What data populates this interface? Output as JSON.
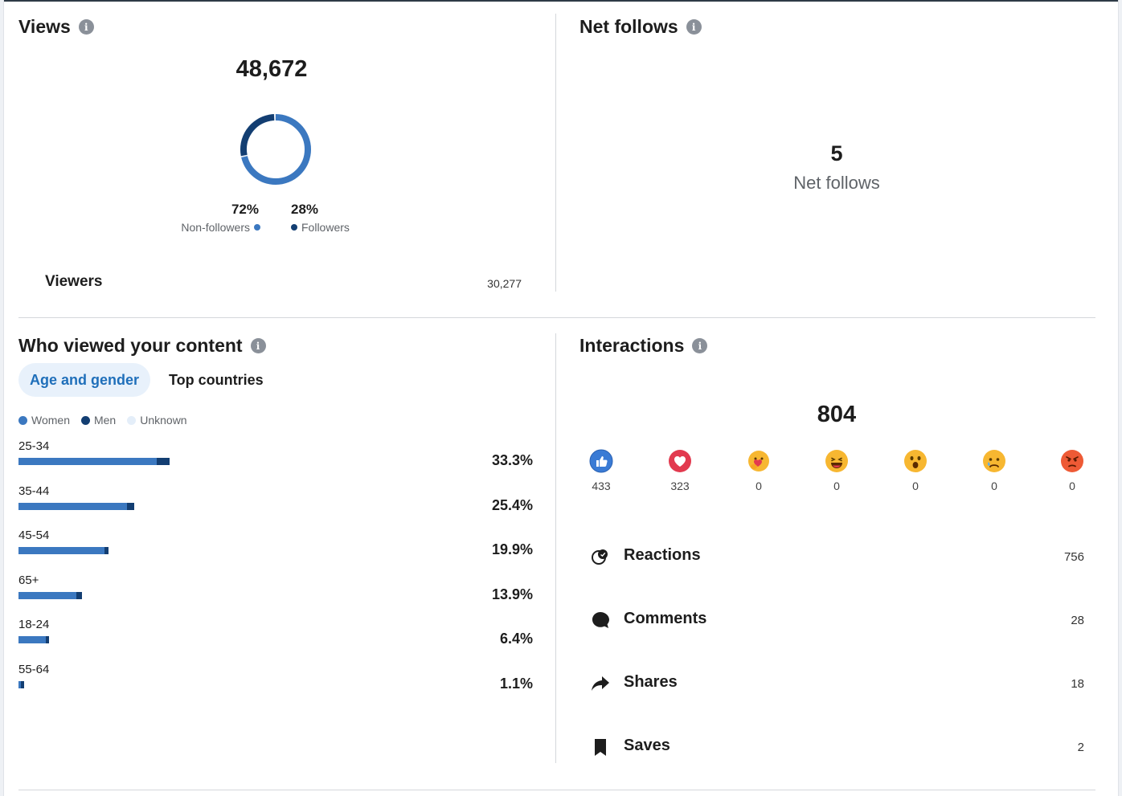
{
  "views": {
    "title": "Views",
    "total": "48,672",
    "non_followers_pct": "72%",
    "non_followers_label": "Non-followers",
    "followers_pct": "28%",
    "followers_label": "Followers",
    "viewers_label": "Viewers",
    "viewers_value": "30,277",
    "colors": {
      "non_followers": "#3b78c0",
      "followers": "#133e72"
    },
    "share": {
      "non_followers": 72,
      "followers": 28
    }
  },
  "net_follows": {
    "title": "Net follows",
    "value": "5",
    "label": "Net follows"
  },
  "who_viewed": {
    "title": "Who viewed your content",
    "tabs": [
      {
        "label": "Age and gender",
        "active": true
      },
      {
        "label": "Top countries",
        "active": false
      }
    ],
    "legend": [
      {
        "label": "Women",
        "color": "#3b78c0"
      },
      {
        "label": "Men",
        "color": "#133e72"
      },
      {
        "label": "Unknown",
        "color": "#e4eef9"
      }
    ],
    "age_groups": [
      {
        "label": "25-34",
        "pct": "33.3%",
        "total": 33.3,
        "men": 2.8
      },
      {
        "label": "35-44",
        "pct": "25.4%",
        "total": 25.4,
        "men": 1.5
      },
      {
        "label": "45-54",
        "pct": "19.9%",
        "total": 19.9,
        "men": 0.9
      },
      {
        "label": "65+",
        "pct": "13.9%",
        "total": 13.9,
        "men": 1.2
      },
      {
        "label": "18-24",
        "pct": "6.4%",
        "total": 6.4,
        "men": 0.4
      },
      {
        "label": "55-64",
        "pct": "1.1%",
        "total": 1.1,
        "men": 0.6
      }
    ]
  },
  "interactions": {
    "title": "Interactions",
    "total": "804",
    "reactions_breakdown": [
      {
        "icon": "like-icon",
        "count": "433"
      },
      {
        "icon": "love-icon",
        "count": "323"
      },
      {
        "icon": "support-icon",
        "count": "0"
      },
      {
        "icon": "funny-icon",
        "count": "0"
      },
      {
        "icon": "insightful-icon",
        "count": "0"
      },
      {
        "icon": "sad-icon",
        "count": "0"
      },
      {
        "icon": "angry-icon",
        "count": "0"
      }
    ],
    "rows": [
      {
        "icon": "reactions-icon",
        "label": "Reactions",
        "value": "756"
      },
      {
        "icon": "comment-icon",
        "label": "Comments",
        "value": "28"
      },
      {
        "icon": "share-icon",
        "label": "Shares",
        "value": "18"
      },
      {
        "icon": "bookmark-icon",
        "label": "Saves",
        "value": "2"
      }
    ]
  }
}
